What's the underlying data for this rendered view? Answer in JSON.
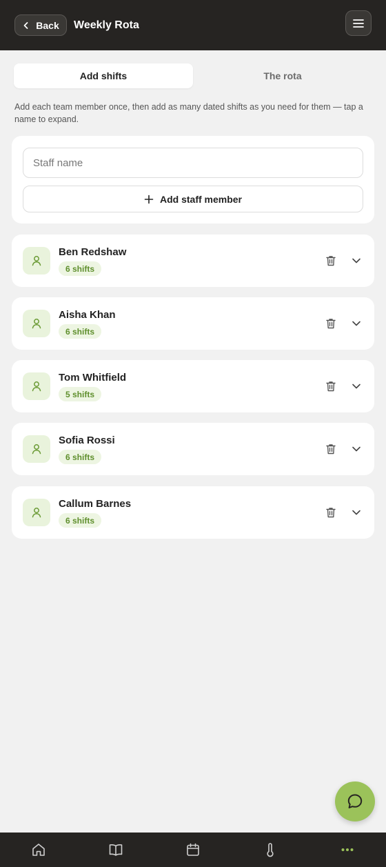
{
  "header": {
    "back_label": "Back",
    "title": "Weekly Rota",
    "menu_icon": "menu-icon"
  },
  "tabs": [
    {
      "label": "Add shifts",
      "active": true
    },
    {
      "label": "The rota",
      "active": false
    }
  ],
  "hint": "Add each team member once, then add as many dated shifts as you need for them — tap a name to expand.",
  "add_form": {
    "placeholder": "Staff name",
    "value": "",
    "button_label": "Add staff member"
  },
  "staff": [
    {
      "name": "Ben Redshaw",
      "shifts": "6 shifts"
    },
    {
      "name": "Aisha Khan",
      "shifts": "6 shifts"
    },
    {
      "name": "Tom Whitfield",
      "shifts": "5 shifts"
    },
    {
      "name": "Sofia Rossi",
      "shifts": "6 shifts"
    },
    {
      "name": "Callum Barnes",
      "shifts": "6 shifts"
    }
  ],
  "bottom_nav": [
    {
      "icon": "home-icon",
      "active": false
    },
    {
      "icon": "book-icon",
      "active": false
    },
    {
      "icon": "calendar-icon",
      "active": false
    },
    {
      "icon": "thermometer-icon",
      "active": false
    },
    {
      "icon": "more-icon",
      "active": true
    }
  ],
  "colors": {
    "accent": "#9bc25a",
    "badge_text": "#5f8f2d",
    "badge_bg": "#edf5e2",
    "header_bg": "#262422"
  }
}
